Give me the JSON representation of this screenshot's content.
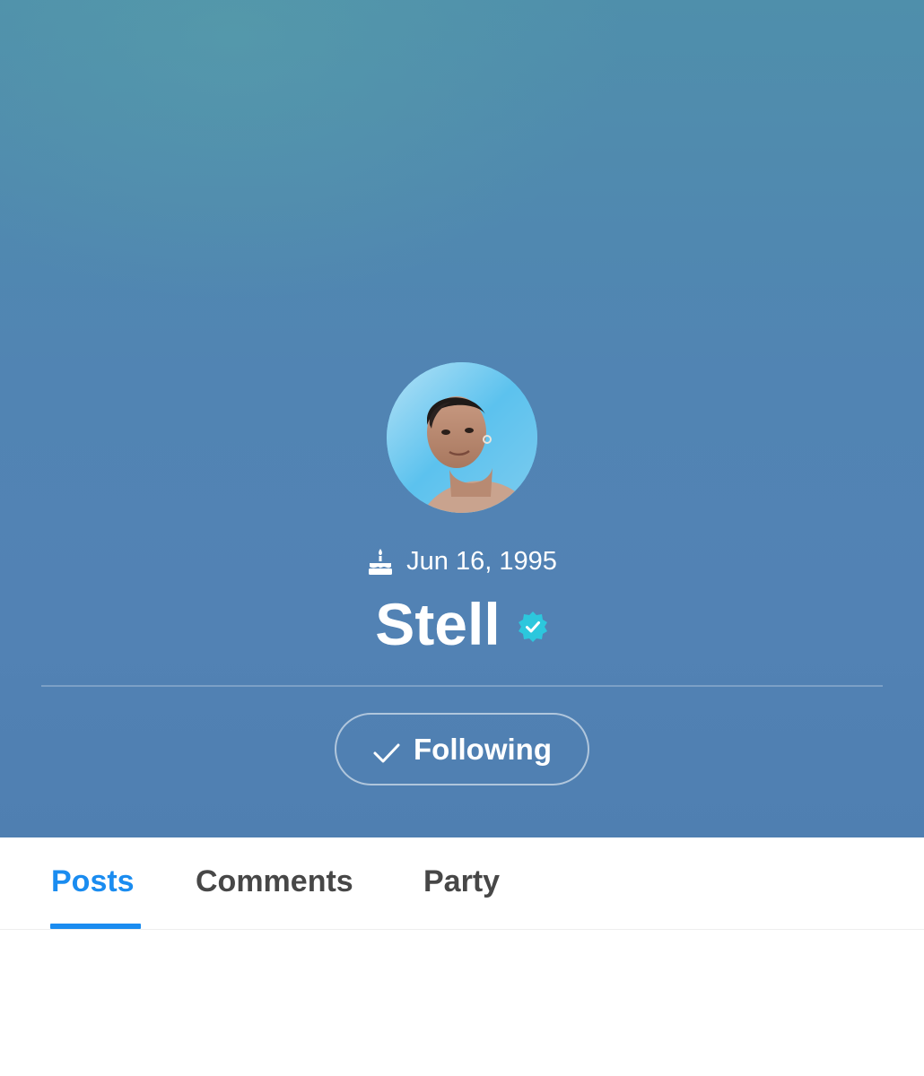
{
  "profile": {
    "birthday": "Jun 16, 1995",
    "birthday_icon": "cake-icon",
    "name": "Stell",
    "verified_icon": "verified-badge-icon",
    "follow_label": "Following",
    "follow_icon": "check-icon"
  },
  "tabs": [
    {
      "label": "Posts",
      "active": true
    },
    {
      "label": "Comments",
      "active": false
    },
    {
      "label": "Party",
      "active": false
    }
  ],
  "colors": {
    "header_background": "#5184b3",
    "accent": "#1a8cf0",
    "verified_badge": "#2cc7dd",
    "tab_inactive": "#474747"
  }
}
